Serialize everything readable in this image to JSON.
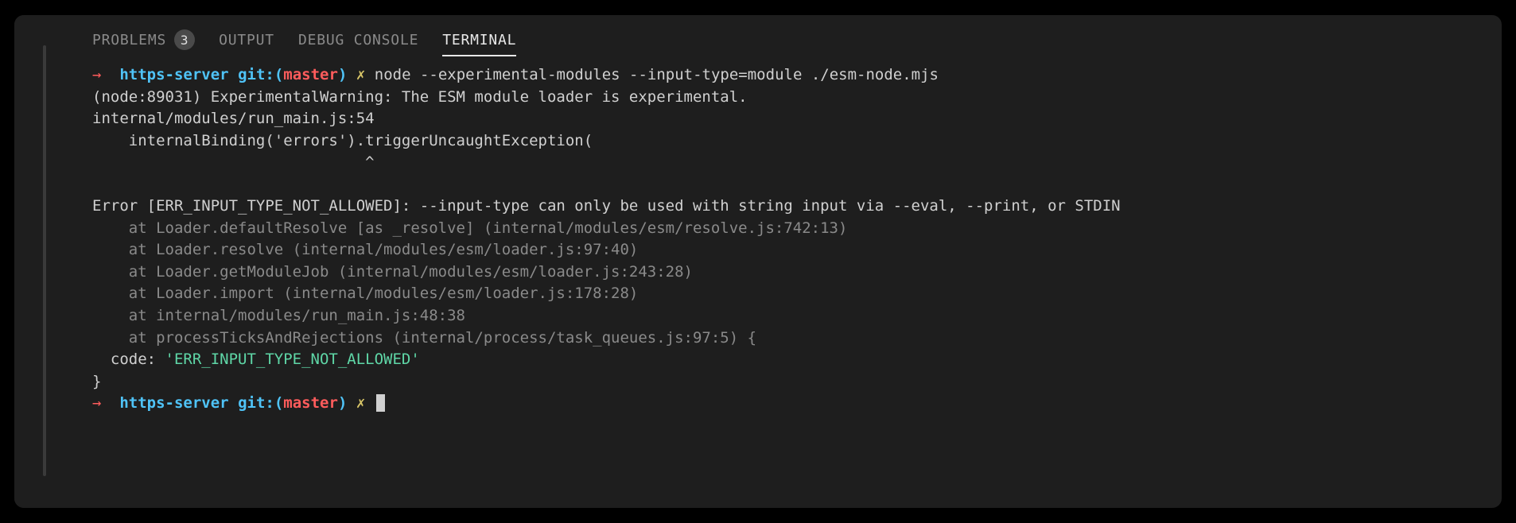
{
  "tabs": {
    "problems": {
      "label": "PROBLEMS",
      "badge": "3"
    },
    "output": {
      "label": "OUTPUT"
    },
    "debug": {
      "label": "DEBUG CONSOLE"
    },
    "terminal": {
      "label": "TERMINAL"
    }
  },
  "prompt": {
    "arrow": "→",
    "dir": "https-server",
    "git": "git:",
    "paren_open": "(",
    "branch": "master",
    "paren_close": ")",
    "dirty": "✗"
  },
  "terminal": {
    "command": "node --experimental-modules --input-type=module ./esm-node.mjs",
    "lines": {
      "l1": "(node:89031) ExperimentalWarning: The ESM module loader is experimental.",
      "l2": "internal/modules/run_main.js:54",
      "l3": "    internalBinding('errors').triggerUncaughtException(",
      "l4": "                              ^",
      "l5": "",
      "l6": "Error [ERR_INPUT_TYPE_NOT_ALLOWED]: --input-type can only be used with string input via --eval, --print, or STDIN",
      "l7": "    at Loader.defaultResolve [as _resolve] (internal/modules/esm/resolve.js:742:13)",
      "l8": "    at Loader.resolve (internal/modules/esm/loader.js:97:40)",
      "l9": "    at Loader.getModuleJob (internal/modules/esm/loader.js:243:28)",
      "l10": "    at Loader.import (internal/modules/esm/loader.js:178:28)",
      "l11": "    at internal/modules/run_main.js:48:38",
      "l12": "    at processTicksAndRejections (internal/process/task_queues.js:97:5) {",
      "code_key": "  code: ",
      "code_val": "'ERR_INPUT_TYPE_NOT_ALLOWED'",
      "l14": "}"
    }
  }
}
